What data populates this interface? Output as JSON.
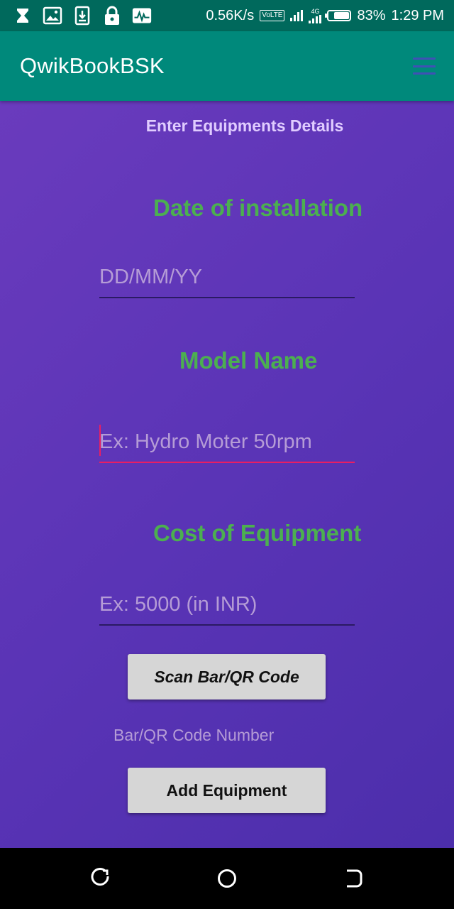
{
  "status_bar": {
    "net_speed": "0.56K/s",
    "volte": "VoLTE",
    "network": "4G",
    "battery": "83%",
    "battery_level": 0.83,
    "time": "1:29 PM"
  },
  "app_bar": {
    "title": "QwikBookBSK",
    "menu_icon": "hamburger-menu-icon"
  },
  "form": {
    "heading": "Enter Equipments Details",
    "date_label": "Date of installation",
    "date_placeholder": "DD/MM/YY",
    "model_label": "Model Name",
    "model_placeholder": "Ex: Hydro Moter 50rpm",
    "cost_label": "Cost of Equipment",
    "cost_placeholder": "Ex: 5000 (in INR)",
    "scan_button": "Scan Bar/QR Code",
    "code_number": "Bar/QR Code Number",
    "add_button": "Add Equipment"
  },
  "colors": {
    "status_bar": "#00695c",
    "app_bar": "#00897b",
    "label_green": "#4caf50",
    "focus_accent": "#e91e63",
    "background_purple": "#5a34b6"
  }
}
